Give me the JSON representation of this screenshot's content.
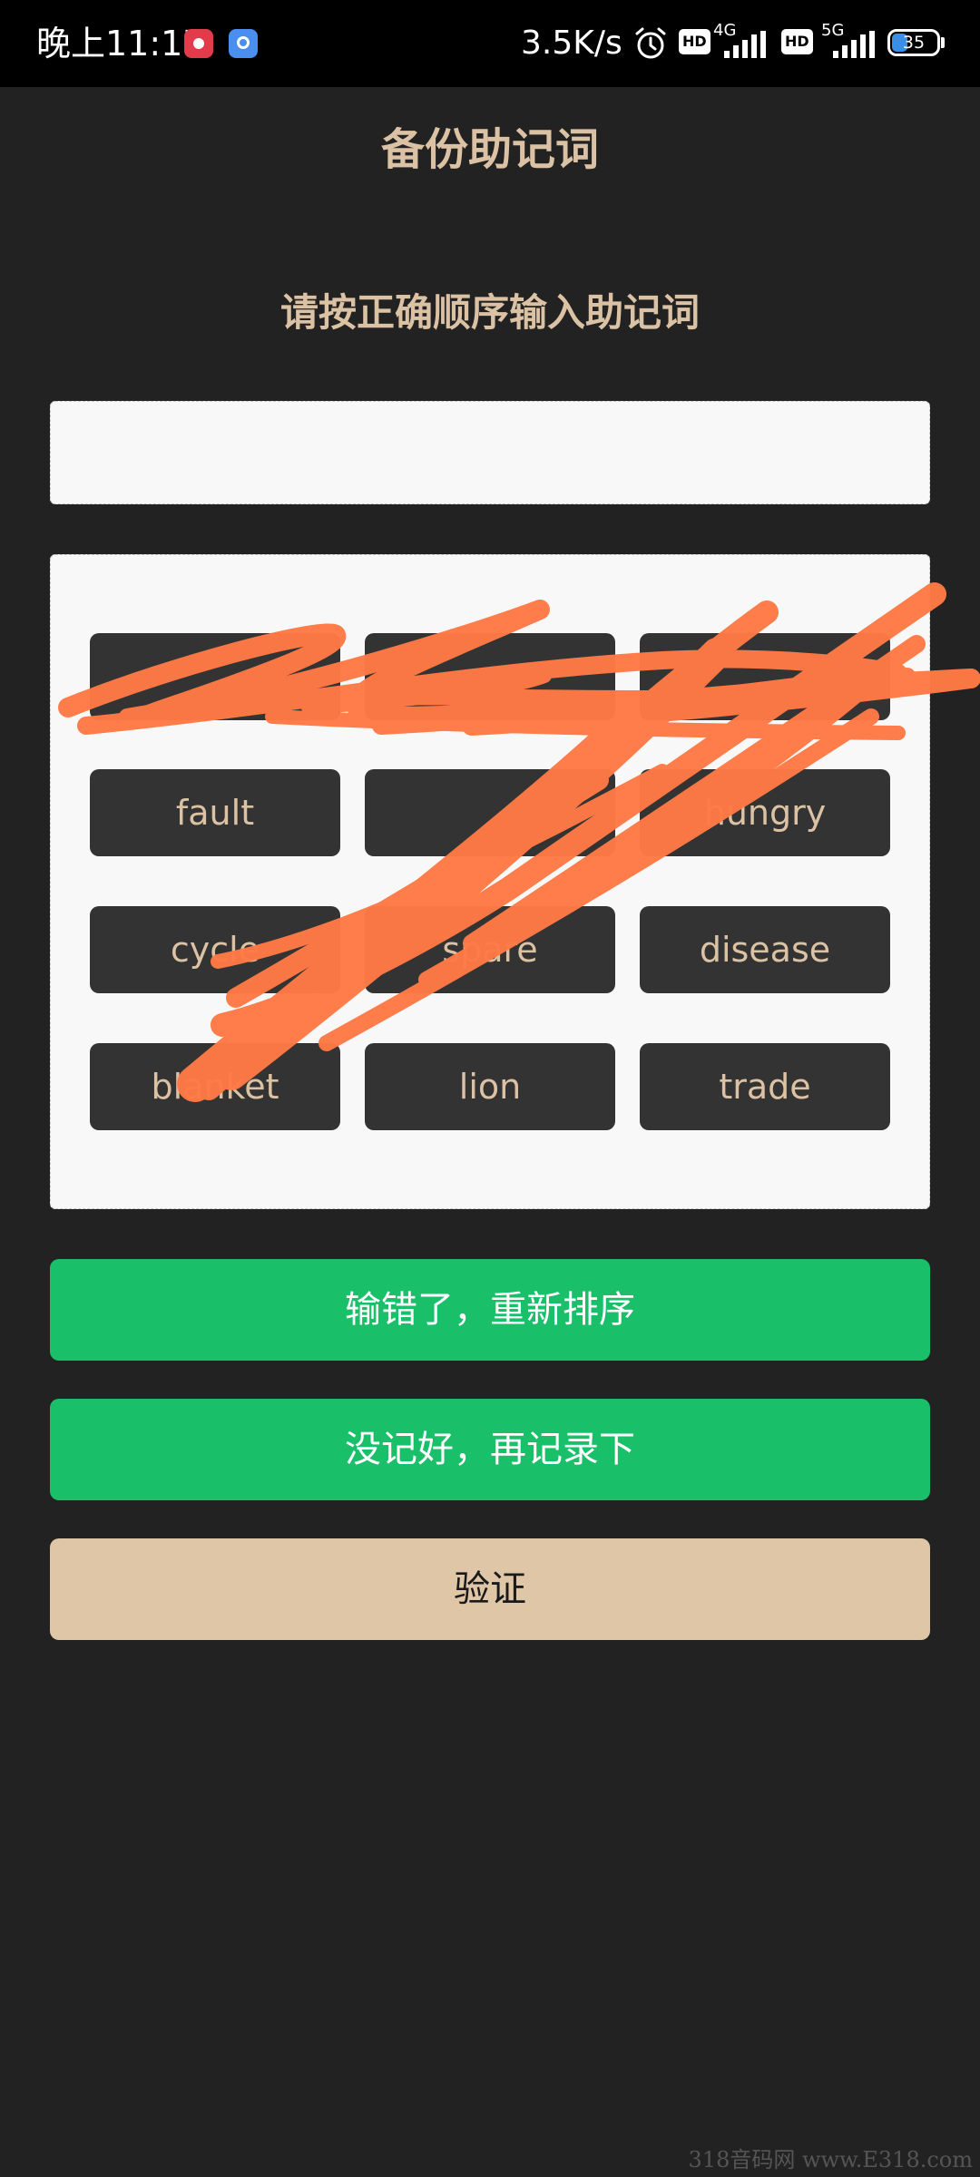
{
  "status_bar": {
    "time": "晚上11:17",
    "net_speed": "3.5K/s",
    "hd_label": "HD",
    "network_1": "4G",
    "network_2": "5G",
    "battery_level": "35",
    "battery_fraction": 0.35,
    "icons": [
      "record-app-icon",
      "navigation-app-icon",
      "alarm-icon",
      "signal-4g-icon",
      "signal-5g-icon",
      "battery-icon"
    ]
  },
  "page": {
    "title": "备份助记词",
    "instruction": "请按正确顺序输入助记词",
    "answer_value": ""
  },
  "words": [
    "",
    "",
    "",
    "fault",
    "",
    "hungry",
    "cycle",
    "spare",
    "disease",
    "blanket",
    "lion",
    "trade"
  ],
  "buttons": {
    "reorder": "输错了，重新排序",
    "rerecord": "没记好，再记录下",
    "verify": "验证"
  },
  "watermark": "318音码网 www.E318.com",
  "colors": {
    "background": "#222222",
    "accent_text": "#dcc2a4",
    "chip_bg": "#333333",
    "green_button": "#19bf69",
    "verify_button": "#dfc6a6",
    "scribble": "#ff7a45"
  }
}
